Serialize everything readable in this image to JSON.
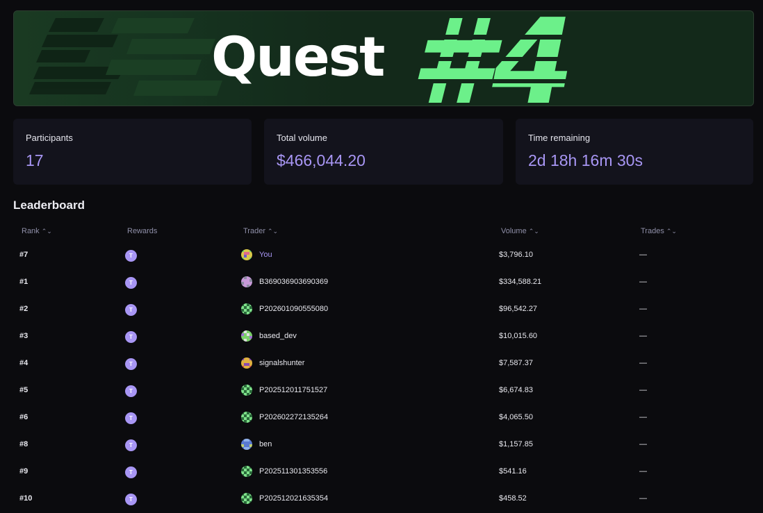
{
  "banner": {
    "title": "Quest",
    "number": "#4"
  },
  "stats": [
    {
      "label": "Participants",
      "value": "17"
    },
    {
      "label": "Total volume",
      "value": "$466,044.20"
    },
    {
      "label": "Time remaining",
      "value": "2d 18h 16m 30s"
    }
  ],
  "leaderboard": {
    "title": "Leaderboard",
    "columns": {
      "rank": "Rank",
      "rewards": "Rewards",
      "trader": "Trader",
      "volume": "Volume",
      "trades": "Trades"
    },
    "sort_icon": "⌃⌄",
    "reward_badge": "T",
    "rows": [
      {
        "rank": "#7",
        "trader": "You",
        "volume": "$3,796.10",
        "trades": "—",
        "avatar": "yellow-pixel-avatar"
      },
      {
        "rank": "#1",
        "trader": "B369036903690369",
        "volume": "$334,588.21",
        "trades": "—",
        "avatar": "purple-pixel-avatar"
      },
      {
        "rank": "#2",
        "trader": "P202601090555080",
        "volume": "$96,542.27",
        "trades": "—",
        "avatar": "green-pixel-avatar"
      },
      {
        "rank": "#3",
        "trader": "based_dev",
        "volume": "$10,015.60",
        "trades": "—",
        "avatar": "mixed-pixel-avatar"
      },
      {
        "rank": "#4",
        "trader": "signalshunter",
        "volume": "$7,587.37",
        "trades": "—",
        "avatar": "orange-pixel-avatar"
      },
      {
        "rank": "#5",
        "trader": "P202512011751527",
        "volume": "$6,674.83",
        "trades": "—",
        "avatar": "green-pixel-avatar"
      },
      {
        "rank": "#6",
        "trader": "P202602272135264",
        "volume": "$4,065.50",
        "trades": "—",
        "avatar": "green-pixel-avatar"
      },
      {
        "rank": "#8",
        "trader": "ben",
        "volume": "$1,157.85",
        "trades": "—",
        "avatar": "blue-pixel-avatar"
      },
      {
        "rank": "#9",
        "trader": "P202511301353556",
        "volume": "$541.16",
        "trades": "—",
        "avatar": "green-pixel-avatar"
      },
      {
        "rank": "#10",
        "trader": "P202512021635354",
        "volume": "$458.52",
        "trades": "—",
        "avatar": "green-pixel-avatar"
      }
    ]
  },
  "colors": {
    "accent": "#a896f4",
    "brand_green": "#6cf08a",
    "background": "#0b0b0e",
    "card": "#13131c"
  }
}
